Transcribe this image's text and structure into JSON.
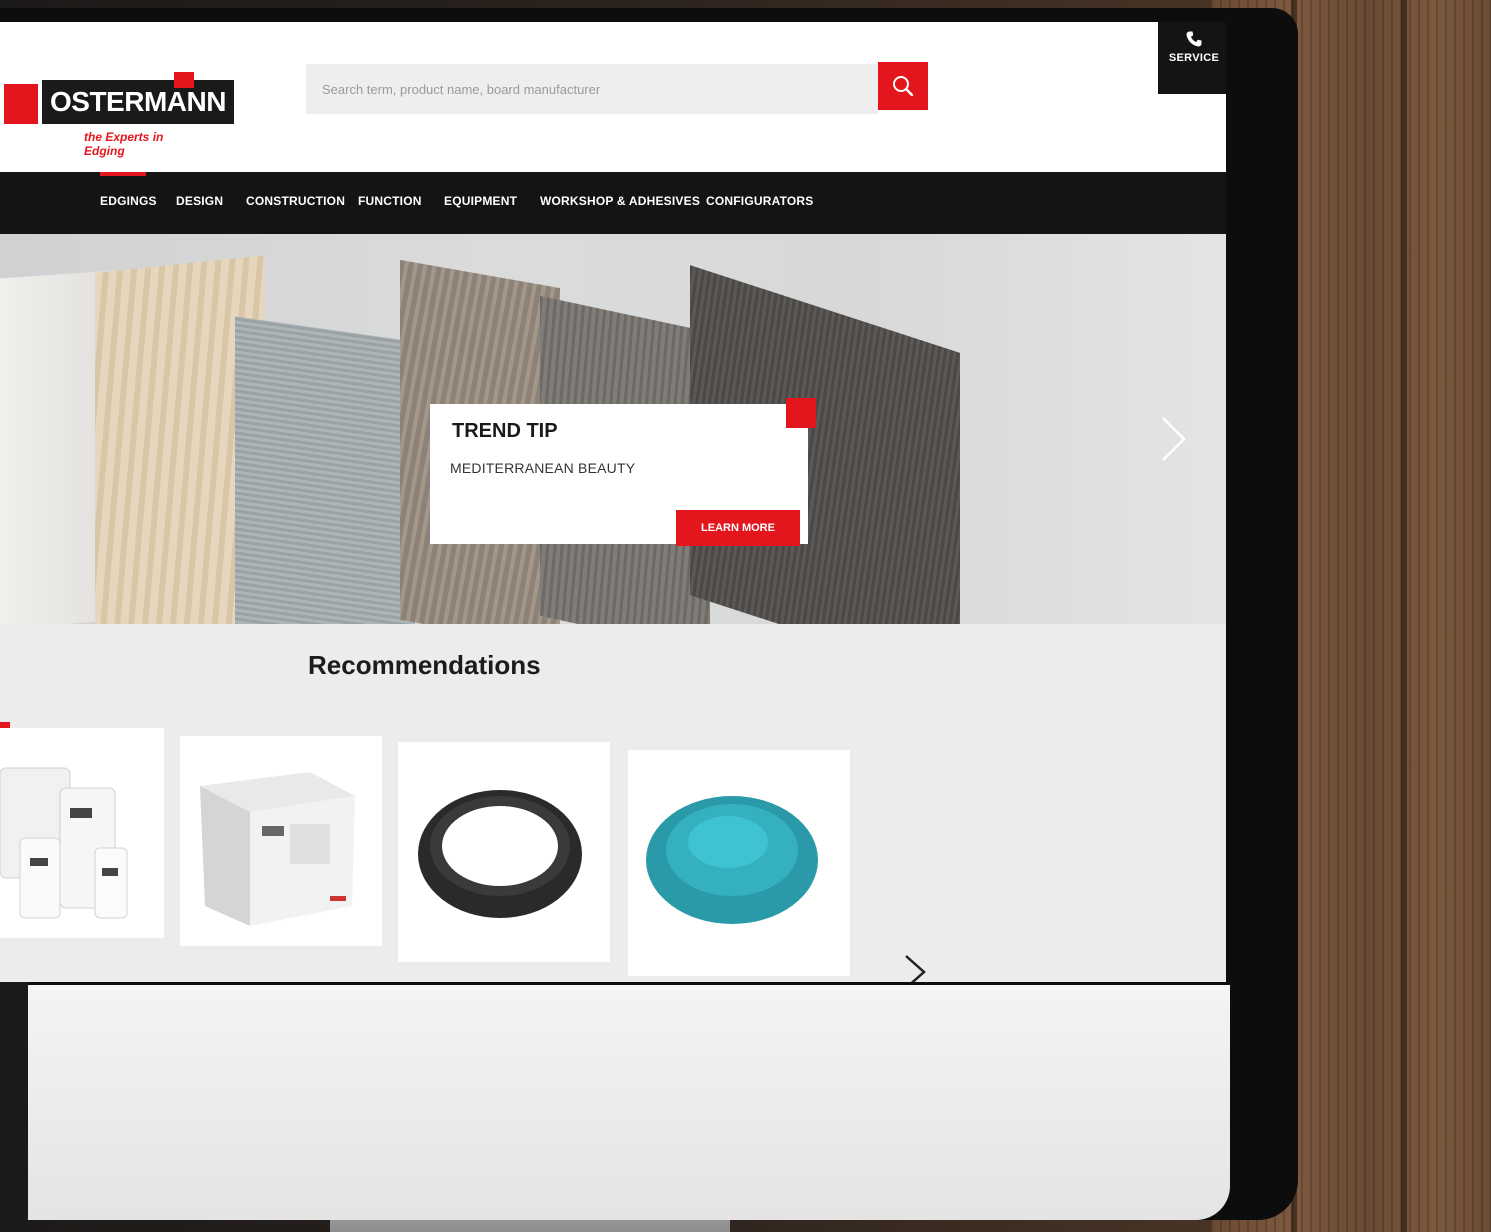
{
  "brand": {
    "name": "OSTERMANN",
    "tagline": "the Experts in Edging",
    "accent": "#e3151d",
    "dark": "#141414"
  },
  "search": {
    "placeholder": "Search term, product name, board manufacturer",
    "button_icon": "search-icon"
  },
  "service": {
    "label": "SERVICE",
    "icon": "phone-icon"
  },
  "nav": {
    "items": [
      {
        "label": "EDGINGS",
        "active": true
      },
      {
        "label": "DESIGN"
      },
      {
        "label": "CONSTRUCTION"
      },
      {
        "label": "FUNCTION"
      },
      {
        "label": "EQUIPMENT"
      },
      {
        "label": "WORKSHOP & ADHESIVES"
      },
      {
        "label": "CONFIGURATORS"
      }
    ]
  },
  "hero": {
    "title": "TREND TIP",
    "subtitle": "MEDITERRANEAN BEAUTY",
    "cta": "LEARN MORE",
    "next_icon": "chevron-right-icon"
  },
  "recommendations": {
    "title": "Recommendations",
    "products": [
      {
        "icon": "cleaning-bottles-icon"
      },
      {
        "icon": "cardboard-box-icon"
      },
      {
        "icon": "black-ring-icon"
      },
      {
        "icon": "turquoise-pellets-icon"
      }
    ],
    "next_icon": "chevron-right-icon"
  }
}
